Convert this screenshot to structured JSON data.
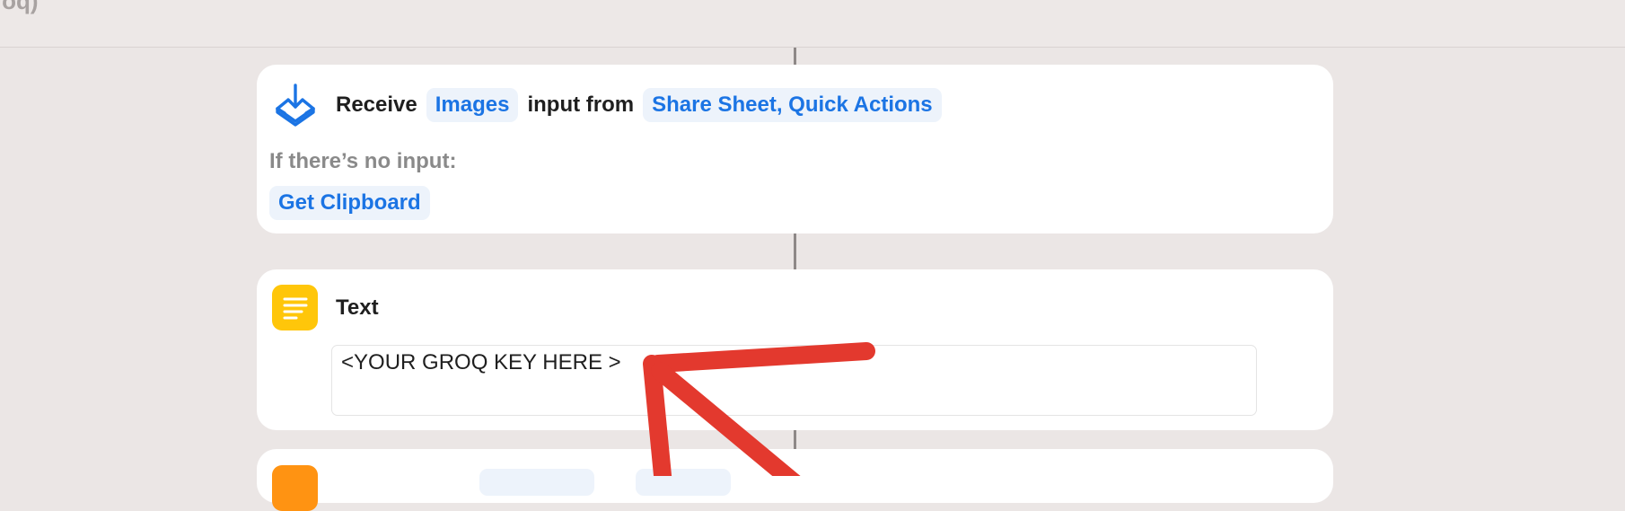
{
  "window": {
    "title_fragment": "roq)"
  },
  "receive_action": {
    "icon": "receive-tray-icon",
    "label_receive": "Receive",
    "input_type": "Images",
    "label_input_from": "input from",
    "sources": "Share Sheet, Quick Actions",
    "fallback_heading": "If there’s no input:",
    "fallback_action": "Get Clipboard"
  },
  "text_action": {
    "icon": "text-lines-icon",
    "title": "Text",
    "value": "<YOUR GROQ KEY HERE >"
  },
  "colors": {
    "accent": "#1b74e4",
    "token_bg": "#edf3fb",
    "text_icon_bg": "#ffc60a",
    "next_icon_bg": "#ff9312",
    "annotation_arrow": "#e3392e",
    "canvas_bg": "#ebe6e5"
  }
}
